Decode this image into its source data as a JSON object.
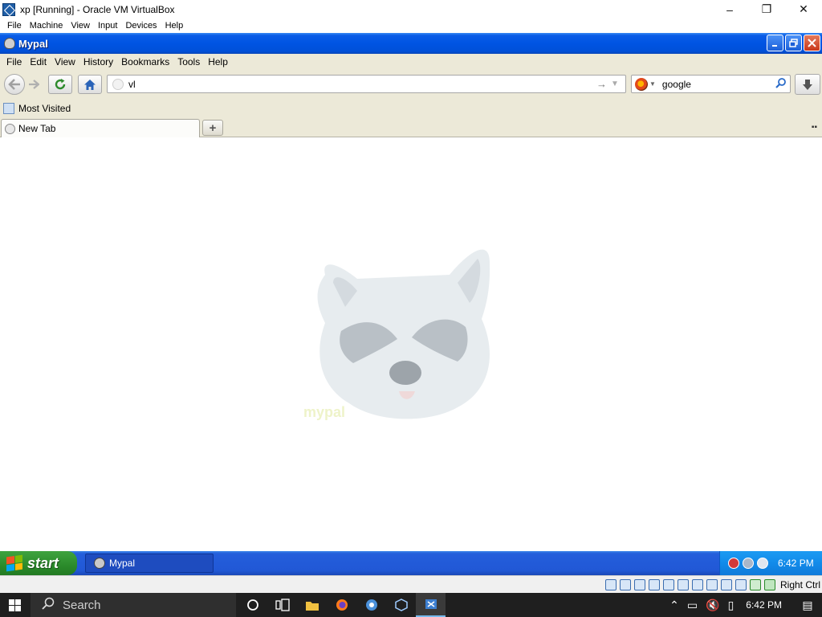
{
  "host": {
    "title": "xp [Running] - Oracle VM VirtualBox",
    "controls": [
      "–",
      "❐",
      "✕"
    ],
    "menu": [
      "File",
      "Machine",
      "View",
      "Input",
      "Devices",
      "Help"
    ],
    "status_host_key": "Right Ctrl"
  },
  "browser": {
    "title": "Mypal",
    "menu": [
      "File",
      "Edit",
      "View",
      "History",
      "Bookmarks",
      "Tools",
      "Help"
    ],
    "url_value": "vl",
    "search_value": "google",
    "bookmark_item": "Most Visited",
    "tab_label": "New Tab",
    "newtab_symbol": "+",
    "brand_text": "mypal"
  },
  "xp_taskbar": {
    "start_label": "start",
    "task_label": "Mypal",
    "clock": "6:42 PM"
  },
  "win10": {
    "search_label": "Search",
    "clock": "6:42 PM"
  },
  "colors": {
    "xp_blue": "#0054e3",
    "xp_green": "#2b8b2b",
    "chrome_beige": "#ece9d8",
    "w10_dark": "#1f1f1f"
  }
}
